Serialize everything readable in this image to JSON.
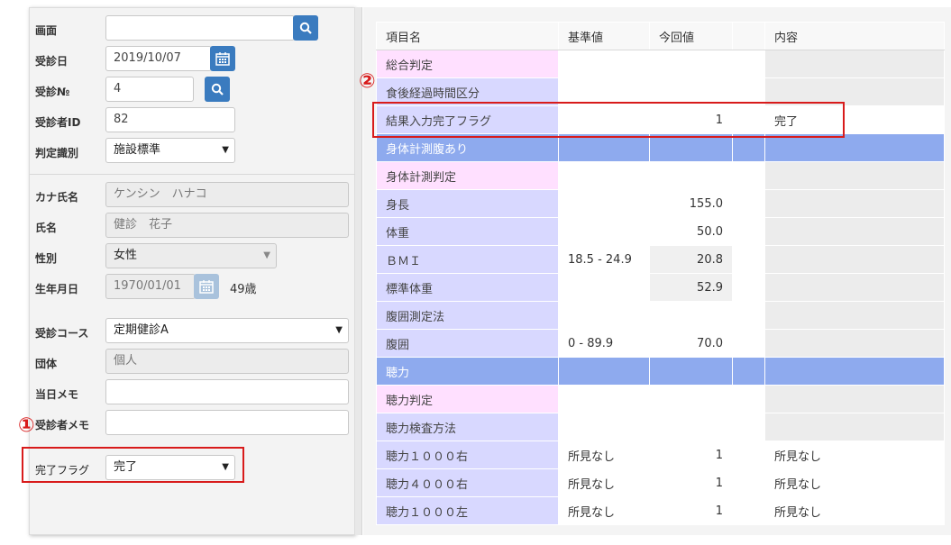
{
  "form": {
    "screen": {
      "label": "画面",
      "value": ""
    },
    "visit_date": {
      "label": "受診日",
      "value": "2019/10/07"
    },
    "visit_no": {
      "label": "受診№",
      "value": "4"
    },
    "patient_id": {
      "label": "受診者ID",
      "value": "82"
    },
    "judge_type": {
      "label": "判定識別",
      "value": "施設標準"
    },
    "kana_name": {
      "label": "カナ氏名",
      "value": "ケンシン　ハナコ"
    },
    "name": {
      "label": "氏名",
      "value": "健診　花子"
    },
    "sex": {
      "label": "性別",
      "value": "女性"
    },
    "birth_date": {
      "label": "生年月日",
      "value": "1970/01/01",
      "age": "49歳"
    },
    "course": {
      "label": "受診コース",
      "value": "定期健診A"
    },
    "group": {
      "label": "団体",
      "value": "個人"
    },
    "day_memo": {
      "label": "当日メモ",
      "value": ""
    },
    "patient_memo": {
      "label": "受診者メモ",
      "value": ""
    },
    "complete_flag": {
      "label": "完了フラグ",
      "value": "完了"
    }
  },
  "markers": {
    "one": "①",
    "two": "②"
  },
  "grid": {
    "headers": [
      "項目名",
      "基準値",
      "今回値",
      "",
      "内容"
    ],
    "rows": [
      {
        "name": "総合判定",
        "ref": "",
        "value": "",
        "flag": "",
        "content": ""
      },
      {
        "name": "食後経過時間区分",
        "ref": "",
        "value": "",
        "flag": "",
        "content": ""
      },
      {
        "name": "結果入力完了フラグ",
        "ref": "",
        "value": "1",
        "flag": "",
        "content": "完了"
      },
      {
        "name": "身体計測腹あり",
        "ref": "",
        "value": "",
        "flag": "",
        "content": ""
      },
      {
        "name": "身体計測判定",
        "ref": "",
        "value": "",
        "flag": "",
        "content": ""
      },
      {
        "name": "身長",
        "ref": "",
        "value": "155.0",
        "flag": "",
        "content": ""
      },
      {
        "name": "体重",
        "ref": "",
        "value": "50.0",
        "flag": "",
        "content": ""
      },
      {
        "name": "ＢＭＩ",
        "ref": "18.5 - 24.9",
        "value": "20.8",
        "flag": "",
        "content": ""
      },
      {
        "name": "標準体重",
        "ref": "",
        "value": "52.9",
        "flag": "",
        "content": ""
      },
      {
        "name": "腹囲測定法",
        "ref": "",
        "value": "",
        "flag": "",
        "content": ""
      },
      {
        "name": "腹囲",
        "ref": "0 - 89.9",
        "value": "70.0",
        "flag": "",
        "content": ""
      },
      {
        "name": "聴力",
        "ref": "",
        "value": "",
        "flag": "",
        "content": ""
      },
      {
        "name": "聴力判定",
        "ref": "",
        "value": "",
        "flag": "",
        "content": ""
      },
      {
        "name": "聴力検査方法",
        "ref": "",
        "value": "",
        "flag": "",
        "content": ""
      },
      {
        "name": "聴力１０００右",
        "ref": "所見なし",
        "value": "1",
        "flag": "",
        "content": "所見なし"
      },
      {
        "name": "聴力４０００右",
        "ref": "所見なし",
        "value": "1",
        "flag": "",
        "content": "所見なし"
      },
      {
        "name": "聴力１０００左",
        "ref": "所見なし",
        "value": "1",
        "flag": "",
        "content": "所見なし"
      }
    ]
  },
  "colors": {
    "accent_button": "#3a7bbf",
    "annotation_red": "#d81b1b",
    "section_row": "#8eaaee",
    "name_cell": "#d8d8ff",
    "judge_cell": "#ffe0ff"
  }
}
